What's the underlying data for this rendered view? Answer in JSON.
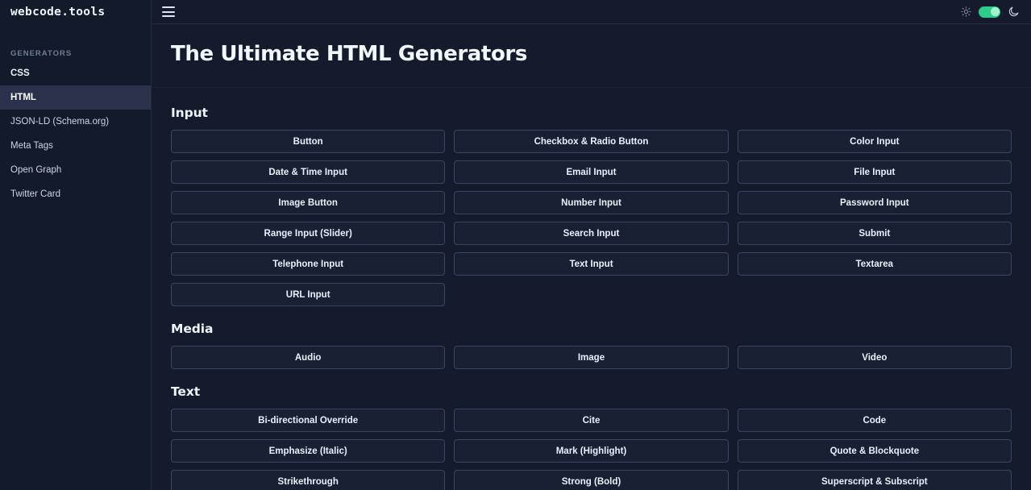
{
  "brand": {
    "name": "webcode.tools"
  },
  "sidebar": {
    "section_label": "GENERATORS",
    "items": [
      {
        "label": "CSS",
        "active": false
      },
      {
        "label": "HTML",
        "active": true
      },
      {
        "label": "JSON-LD (Schema.org)",
        "active": false
      },
      {
        "label": "Meta Tags",
        "active": false
      },
      {
        "label": "Open Graph",
        "active": false
      },
      {
        "label": "Twitter Card",
        "active": false
      }
    ]
  },
  "topbar": {
    "menu_icon": "hamburger-icon",
    "sun_icon": "sun-icon",
    "moon_icon": "moon-icon",
    "theme_toggle": {
      "state": "on",
      "accent": "#2ecb8a"
    }
  },
  "header": {
    "title": "The Ultimate HTML Generators"
  },
  "colors": {
    "page_bg": "#151b2c",
    "sidebar_bg": "#131a2a",
    "active_nav_bg": "#29324a",
    "button_border": "#3a4566",
    "button_bg": "#192034",
    "accent_green": "#2ecb8a",
    "muted_label": "#6e7d9c"
  },
  "sections": [
    {
      "title": "Input",
      "items": [
        "Button",
        "Checkbox & Radio Button",
        "Color Input",
        "Date & Time Input",
        "Email Input",
        "File Input",
        "Image Button",
        "Number Input",
        "Password Input",
        "Range Input (Slider)",
        "Search Input",
        "Submit",
        "Telephone Input",
        "Text Input",
        "Textarea",
        "URL Input"
      ]
    },
    {
      "title": "Media",
      "items": [
        "Audio",
        "Image",
        "Video"
      ]
    },
    {
      "title": "Text",
      "items": [
        "Bi-directional Override",
        "Cite",
        "Code",
        "Emphasize (Italic)",
        "Mark (Highlight)",
        "Quote & Blockquote",
        "Strikethrough",
        "Strong (Bold)",
        "Superscript & Subscript"
      ]
    }
  ]
}
